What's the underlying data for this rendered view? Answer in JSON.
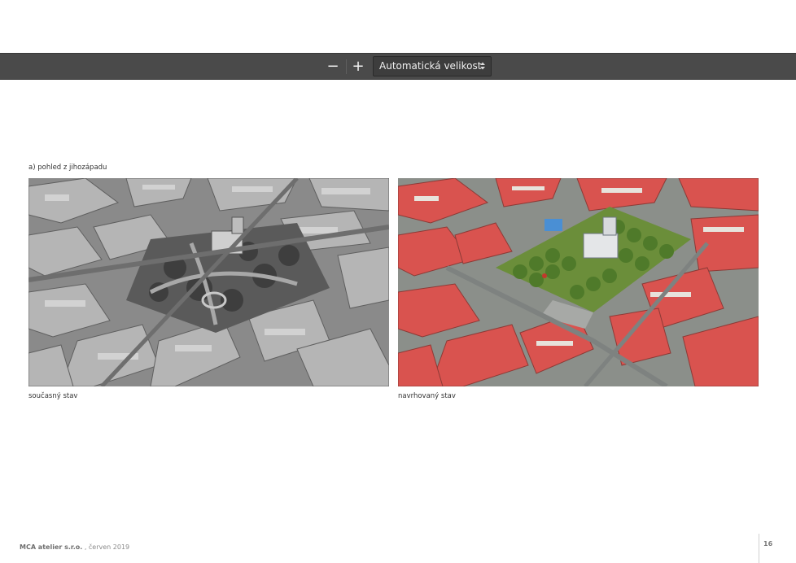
{
  "toolbar": {
    "zoom_out_label": "−",
    "zoom_in_label": "+",
    "zoom_select_value": "Automatická velikost"
  },
  "page": {
    "section_caption": "a) pohled z jihozápadu",
    "left_caption": "současný stav",
    "right_caption": "navrhovaný stav",
    "footer_company": "MCA atelier s.r.o.",
    "footer_date": " , červen 2019",
    "page_number": "16"
  },
  "colors": {
    "toolbar_bg": "#4a4a4a",
    "roof_red": "#d9534f",
    "park_green": "#6b8e3a"
  }
}
